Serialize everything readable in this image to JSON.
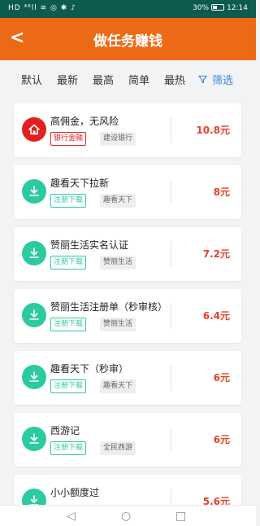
{
  "status_bar": {
    "left": "HD ⁴⁶ll ≋ ◎ ✱ ♪",
    "battery": "30%",
    "time": "12:14"
  },
  "header": {
    "back_icon": "chevron-left-icon",
    "back_glyph": "<",
    "title": "做任务赚钱"
  },
  "tabs": [
    {
      "label": "默认"
    },
    {
      "label": "最新"
    },
    {
      "label": "最高"
    },
    {
      "label": "简单"
    },
    {
      "label": "最热"
    }
  ],
  "filter": {
    "icon": "filter-icon",
    "label": "筛选"
  },
  "tasks": [
    {
      "icon": "home-icon",
      "name": "高佣金，无风险",
      "tag": "银行金融",
      "company": "建设银行",
      "reward": "10.8元"
    },
    {
      "icon": "download-icon",
      "name": "趣看天下拉新",
      "tag": "注册下载",
      "company": "趣看天下",
      "reward": "8元"
    },
    {
      "icon": "download-icon",
      "name": "赞丽生活实名认证",
      "tag": "注册下载",
      "company": "赞丽生活",
      "reward": "7.2元"
    },
    {
      "icon": "download-icon",
      "name": "赞丽生活注册单（秒审核）",
      "tag": "注册下载",
      "company": "赞丽生活",
      "reward": "6.4元"
    },
    {
      "icon": "download-icon",
      "name": "趣看天下（秒审）",
      "tag": "注册下载",
      "company": "趣看天下",
      "reward": "6元"
    },
    {
      "icon": "download-icon",
      "name": "西游记",
      "tag": "注册下载",
      "company": "全民西游",
      "reward": "6元"
    },
    {
      "icon": "download-icon",
      "name": "小小额度过",
      "tag": "",
      "company": "",
      "reward": "5.6元"
    }
  ],
  "nav": {
    "back_glyph": "◁",
    "home_glyph": "○",
    "recent_glyph": "□"
  },
  "colors": {
    "header": "#ec6a16",
    "status_bar": "#0d5a4e",
    "accent_green": "#2ccaa0",
    "accent_red": "#e22020",
    "reward": "#e6402a",
    "filter": "#3b86d8"
  }
}
